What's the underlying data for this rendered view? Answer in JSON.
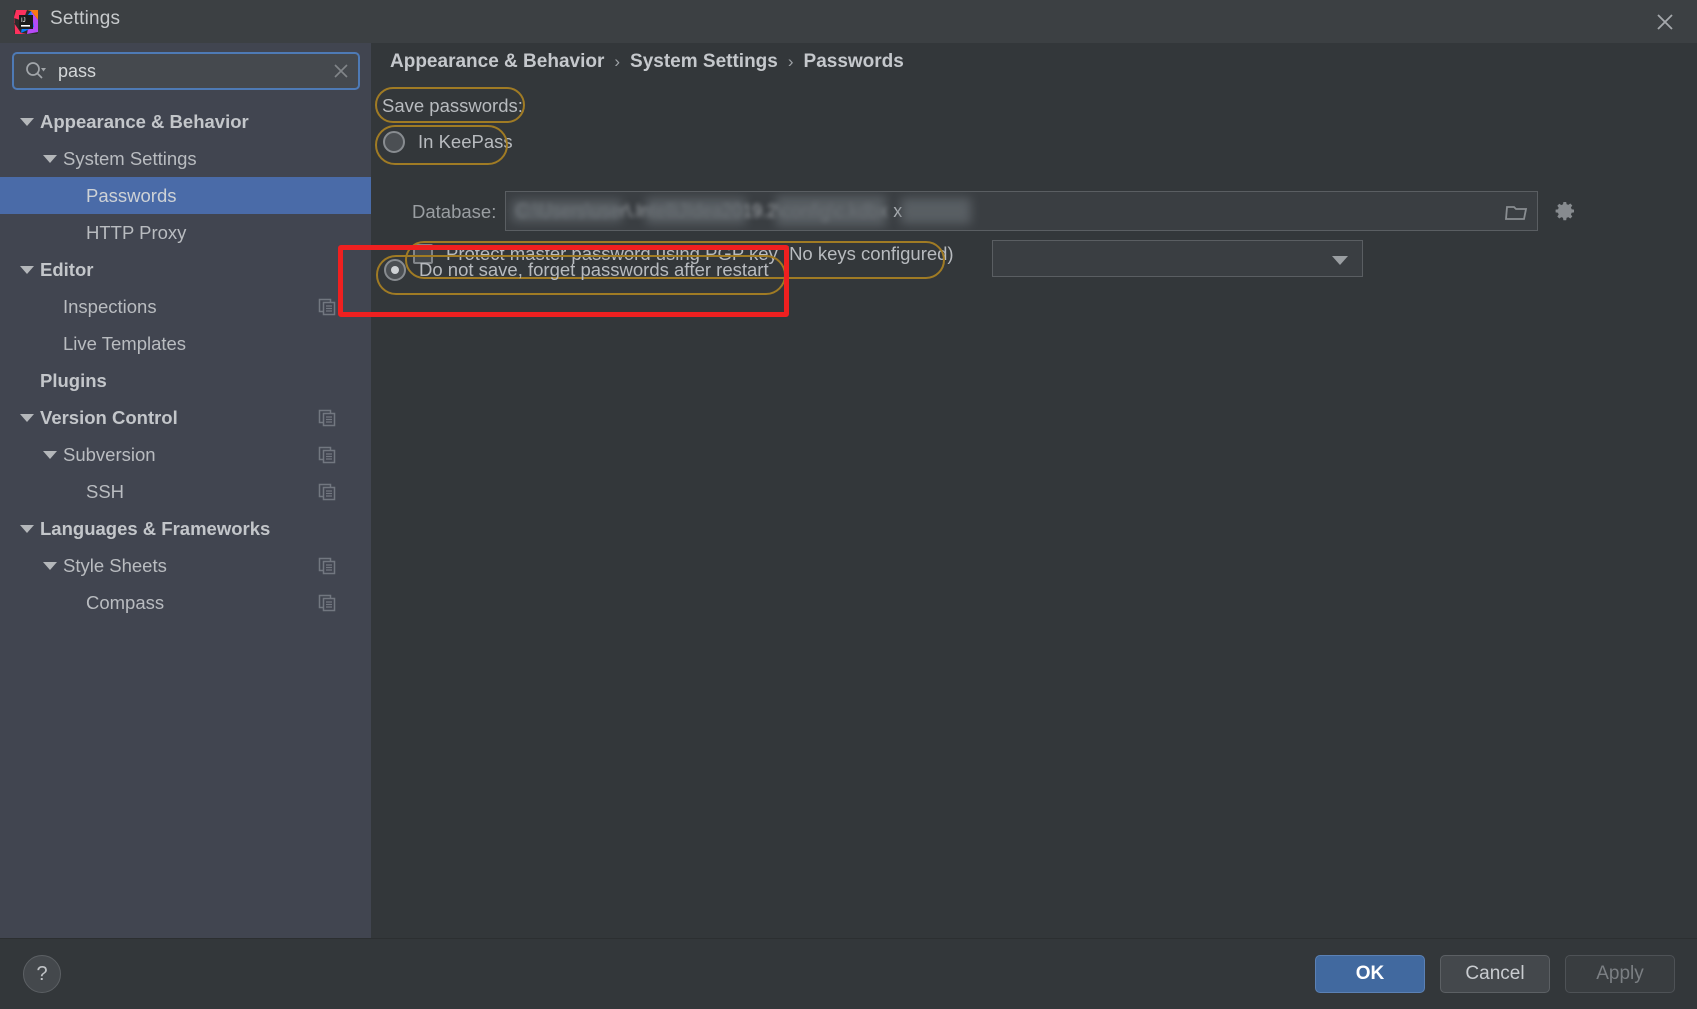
{
  "window": {
    "title": "Settings",
    "app_icon": "intellij-idea-icon",
    "close_icon": "close-icon"
  },
  "sidebar": {
    "search": {
      "value": "pass",
      "placeholder": "",
      "icon": "search-icon",
      "clear_icon": "clear-icon"
    },
    "items": [
      {
        "label": "Appearance & Behavior",
        "level": 0,
        "expanded": true,
        "bold": true,
        "selected": false,
        "copy_icon": false
      },
      {
        "label": "System Settings",
        "level": 1,
        "expanded": true,
        "bold": false,
        "selected": false,
        "copy_icon": false
      },
      {
        "label": "Passwords",
        "level": 2,
        "expanded": null,
        "bold": false,
        "selected": true,
        "copy_icon": false
      },
      {
        "label": "HTTP Proxy",
        "level": 2,
        "expanded": null,
        "bold": false,
        "selected": false,
        "copy_icon": false
      },
      {
        "label": "Editor",
        "level": 0,
        "expanded": true,
        "bold": true,
        "selected": false,
        "copy_icon": false
      },
      {
        "label": "Inspections",
        "level": 1,
        "expanded": null,
        "bold": false,
        "selected": false,
        "copy_icon": true
      },
      {
        "label": "Live Templates",
        "level": 1,
        "expanded": null,
        "bold": false,
        "selected": false,
        "copy_icon": false
      },
      {
        "label": "Plugins",
        "level": 0,
        "expanded": null,
        "bold": true,
        "selected": false,
        "copy_icon": false
      },
      {
        "label": "Version Control",
        "level": 0,
        "expanded": true,
        "bold": true,
        "selected": false,
        "copy_icon": true
      },
      {
        "label": "Subversion",
        "level": 1,
        "expanded": true,
        "bold": false,
        "selected": false,
        "copy_icon": true
      },
      {
        "label": "SSH",
        "level": 2,
        "expanded": null,
        "bold": false,
        "selected": false,
        "copy_icon": true
      },
      {
        "label": "Languages & Frameworks",
        "level": 0,
        "expanded": true,
        "bold": true,
        "selected": false,
        "copy_icon": false
      },
      {
        "label": "Style Sheets",
        "level": 1,
        "expanded": true,
        "bold": false,
        "selected": false,
        "copy_icon": true
      },
      {
        "label": "Compass",
        "level": 2,
        "expanded": null,
        "bold": false,
        "selected": false,
        "copy_icon": true
      }
    ]
  },
  "main": {
    "breadcrumb": [
      "Appearance & Behavior",
      "System Settings",
      "Passwords"
    ],
    "breadcrumb_separator": "›",
    "save_passwords_label": "Save passwords:",
    "option_keepass": {
      "label": "In KeePass",
      "selected": false
    },
    "option_forget": {
      "label": "Do not save, forget passwords after restart",
      "selected": true
    },
    "database": {
      "label": "Database:",
      "value_redacted": "C:\\Users\\user\\.IntelliJIdea2019.2\\config\\c.kdbx",
      "value_tail": "x",
      "browse_icon": "folder-icon",
      "gear_icon": "gear-icon"
    },
    "pgp": {
      "label": "Protect master password using PGP key (No keys configured)",
      "checked": false,
      "dropdown_value": "",
      "dropdown_icon": "chevron-down-icon"
    }
  },
  "footer": {
    "help_label": "?",
    "ok_label": "OK",
    "cancel_label": "Cancel",
    "apply_label": "Apply"
  },
  "annotations": {
    "highlight_color": "#ef2020",
    "pill_color": "#a07b24"
  }
}
